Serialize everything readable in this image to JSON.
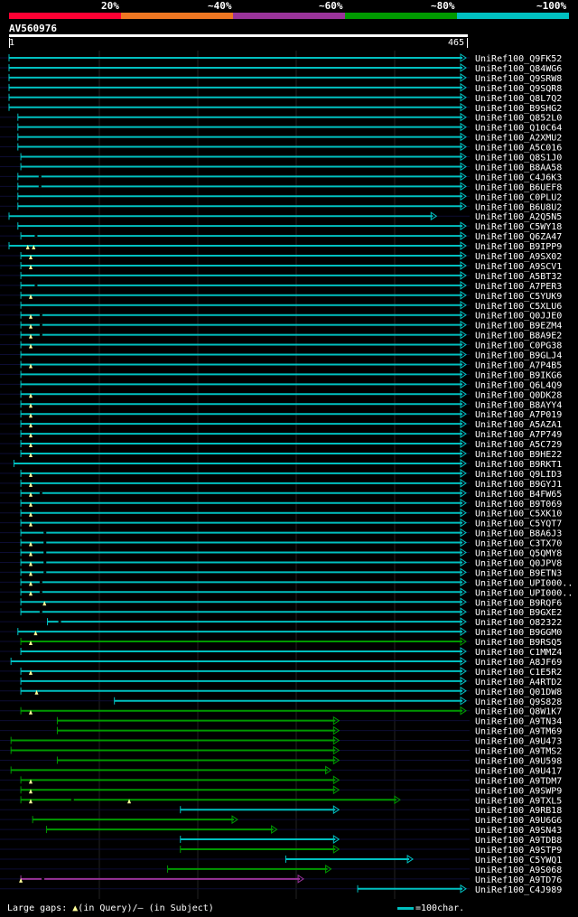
{
  "legend": {
    "labels": [
      "20%",
      "~40%",
      "~60%",
      "~80%",
      "~100%"
    ],
    "colors": [
      "#ff0033",
      "#ee7722",
      "#993399",
      "#009900",
      "#00c0c0"
    ]
  },
  "query": {
    "name": "AV560976",
    "start": "1",
    "end": "465",
    "length": 465
  },
  "footer": {
    "gaps_label": "Large gaps:",
    "query_gap": "(in Query)/",
    "subject_gap": "– (in Subject)",
    "scale_label": "=100char."
  },
  "hits": [
    {
      "id": "UniRef100_Q9FK52",
      "start": 1,
      "end": 465,
      "color": "cyan"
    },
    {
      "id": "UniRef100_Q84WG6",
      "start": 1,
      "end": 465,
      "color": "cyan"
    },
    {
      "id": "UniRef100_Q9SRW8",
      "start": 1,
      "end": 465,
      "color": "cyan"
    },
    {
      "id": "UniRef100_Q9SQR8",
      "start": 1,
      "end": 465,
      "color": "cyan"
    },
    {
      "id": "UniRef100_Q8L7Q2",
      "start": 1,
      "end": 465,
      "color": "cyan"
    },
    {
      "id": "UniRef100_B9SHG2",
      "start": 1,
      "end": 465,
      "color": "cyan"
    },
    {
      "id": "UniRef100_Q852L0",
      "start": 10,
      "end": 465,
      "color": "cyan"
    },
    {
      "id": "UniRef100_Q10C64",
      "start": 10,
      "end": 465,
      "color": "cyan"
    },
    {
      "id": "UniRef100_A2XMU2",
      "start": 10,
      "end": 465,
      "color": "cyan"
    },
    {
      "id": "UniRef100_A5C016",
      "start": 10,
      "end": 465,
      "color": "cyan"
    },
    {
      "id": "UniRef100_Q8S1J0",
      "start": 13,
      "end": 465,
      "color": "cyan"
    },
    {
      "id": "UniRef100_B8AA58",
      "start": 13,
      "end": 465,
      "color": "cyan"
    },
    {
      "id": "UniRef100_C4J6K3",
      "start": 10,
      "end": 465,
      "color": "cyan",
      "sgap": 32
    },
    {
      "id": "UniRef100_B6UEF8",
      "start": 10,
      "end": 465,
      "color": "cyan",
      "sgap": 32
    },
    {
      "id": "UniRef100_C0PLU2",
      "start": 10,
      "end": 465,
      "color": "cyan"
    },
    {
      "id": "UniRef100_B6U8U2",
      "start": 10,
      "end": 465,
      "color": "cyan"
    },
    {
      "id": "UniRef100_A2Q5N5",
      "start": 1,
      "end": 435,
      "color": "cyan"
    },
    {
      "id": "UniRef100_C5WY18",
      "start": 10,
      "end": 465,
      "color": "cyan"
    },
    {
      "id": "UniRef100_Q6ZA47",
      "start": 13,
      "end": 465,
      "color": "cyan",
      "sgap": 28
    },
    {
      "id": "UniRef100_B9IPP9",
      "start": 1,
      "end": 465,
      "color": "cyan",
      "qgap": [
        20,
        26
      ]
    },
    {
      "id": "UniRef100_A9SX02",
      "start": 13,
      "end": 465,
      "color": "cyan",
      "qgap": [
        23
      ]
    },
    {
      "id": "UniRef100_A9SCV1",
      "start": 13,
      "end": 465,
      "color": "cyan",
      "qgap": [
        23
      ]
    },
    {
      "id": "UniRef100_A5BT32",
      "start": 13,
      "end": 465,
      "color": "cyan"
    },
    {
      "id": "UniRef100_A7PER3",
      "start": 13,
      "end": 465,
      "color": "cyan",
      "sgap": 28
    },
    {
      "id": "UniRef100_C5YUK9",
      "start": 13,
      "end": 465,
      "color": "cyan",
      "qgap": [
        23
      ]
    },
    {
      "id": "UniRef100_C5XLU6",
      "start": 13,
      "end": 465,
      "color": "cyan"
    },
    {
      "id": "UniRef100_Q0JJE0",
      "start": 13,
      "end": 465,
      "color": "cyan",
      "qgap": [
        23
      ],
      "sgap": 33
    },
    {
      "id": "UniRef100_B9EZM4",
      "start": 13,
      "end": 465,
      "color": "cyan",
      "qgap": [
        23
      ],
      "sgap": 33
    },
    {
      "id": "UniRef100_B8A9E2",
      "start": 13,
      "end": 465,
      "color": "cyan",
      "qgap": [
        23
      ],
      "sgap": 33
    },
    {
      "id": "UniRef100_C0PG38",
      "start": 13,
      "end": 465,
      "color": "cyan",
      "qgap": [
        23
      ]
    },
    {
      "id": "UniRef100_B9GLJ4",
      "start": 13,
      "end": 465,
      "color": "cyan"
    },
    {
      "id": "UniRef100_A7P4B5",
      "start": 13,
      "end": 465,
      "color": "cyan",
      "qgap": [
        23
      ]
    },
    {
      "id": "UniRef100_B9IKG6",
      "start": 13,
      "end": 465,
      "color": "cyan"
    },
    {
      "id": "UniRef100_Q6L4Q9",
      "start": 13,
      "end": 465,
      "color": "cyan"
    },
    {
      "id": "UniRef100_Q0DK28",
      "start": 13,
      "end": 465,
      "color": "cyan",
      "qgap": [
        23
      ]
    },
    {
      "id": "UniRef100_B8AYY4",
      "start": 13,
      "end": 465,
      "color": "cyan",
      "qgap": [
        23
      ]
    },
    {
      "id": "UniRef100_A7P019",
      "start": 13,
      "end": 465,
      "color": "cyan",
      "qgap": [
        23
      ]
    },
    {
      "id": "UniRef100_A5AZA1",
      "start": 13,
      "end": 465,
      "color": "cyan",
      "qgap": [
        23
      ]
    },
    {
      "id": "UniRef100_A7P749",
      "start": 13,
      "end": 465,
      "color": "cyan",
      "qgap": [
        23
      ]
    },
    {
      "id": "UniRef100_A5C729",
      "start": 13,
      "end": 465,
      "color": "cyan",
      "qgap": [
        23
      ]
    },
    {
      "id": "UniRef100_B9HE22",
      "start": 13,
      "end": 465,
      "color": "cyan",
      "qgap": [
        23
      ]
    },
    {
      "id": "UniRef100_B9RKT1",
      "start": 6,
      "end": 465,
      "color": "cyan"
    },
    {
      "id": "UniRef100_Q9LID3",
      "start": 13,
      "end": 465,
      "color": "cyan",
      "qgap": [
        23
      ]
    },
    {
      "id": "UniRef100_B9GYJ1",
      "start": 13,
      "end": 465,
      "color": "cyan",
      "qgap": [
        23
      ]
    },
    {
      "id": "UniRef100_B4FW65",
      "start": 13,
      "end": 465,
      "color": "cyan",
      "qgap": [
        23
      ],
      "sgap": 33
    },
    {
      "id": "UniRef100_B9T069",
      "start": 13,
      "end": 465,
      "color": "cyan",
      "qgap": [
        23
      ]
    },
    {
      "id": "UniRef100_C5XK10",
      "start": 13,
      "end": 465,
      "color": "cyan",
      "qgap": [
        23
      ]
    },
    {
      "id": "UniRef100_C5YQT7",
      "start": 13,
      "end": 465,
      "color": "cyan",
      "qgap": [
        23
      ]
    },
    {
      "id": "UniRef100_B8A6J3",
      "start": 13,
      "end": 465,
      "color": "cyan",
      "sgap": 37
    },
    {
      "id": "UniRef100_C3TX70",
      "start": 13,
      "end": 465,
      "color": "cyan",
      "qgap": [
        23
      ],
      "sgap": 37
    },
    {
      "id": "UniRef100_Q5QMY8",
      "start": 13,
      "end": 465,
      "color": "cyan",
      "qgap": [
        23
      ],
      "sgap": 37
    },
    {
      "id": "UniRef100_Q0JPV8",
      "start": 13,
      "end": 465,
      "color": "cyan",
      "qgap": [
        23
      ],
      "sgap": 37
    },
    {
      "id": "UniRef100_B9ETN3",
      "start": 13,
      "end": 465,
      "color": "cyan",
      "qgap": [
        23
      ],
      "sgap": 37
    },
    {
      "id": "UniRef100_UPI000..",
      "start": 13,
      "end": 465,
      "color": "cyan",
      "qgap": [
        23
      ],
      "sgap": 33
    },
    {
      "id": "UniRef100_UPI000..",
      "start": 13,
      "end": 465,
      "color": "cyan",
      "qgap": [
        23
      ],
      "sgap": 33
    },
    {
      "id": "UniRef100_B9RQF6",
      "start": 13,
      "end": 465,
      "color": "cyan",
      "qgap": [
        37
      ]
    },
    {
      "id": "UniRef100_B9GXE2",
      "start": 13,
      "end": 465,
      "color": "cyan",
      "sgap": 33
    },
    {
      "id": "UniRef100_O82322",
      "start": 40,
      "end": 465,
      "color": "cyan",
      "sgap": 52
    },
    {
      "id": "UniRef100_B9GGM0",
      "start": 10,
      "end": 465,
      "color": "cyan",
      "qgap": [
        28
      ]
    },
    {
      "id": "UniRef100_B9RSQ5",
      "start": 13,
      "end": 465,
      "color": "green",
      "qgap": [
        23
      ]
    },
    {
      "id": "UniRef100_C1MMZ4",
      "start": 13,
      "end": 465,
      "color": "cyan"
    },
    {
      "id": "UniRef100_A8JF69",
      "start": 3,
      "end": 465,
      "color": "cyan"
    },
    {
      "id": "UniRef100_C1E5R2",
      "start": 13,
      "end": 465,
      "color": "cyan",
      "qgap": [
        23
      ]
    },
    {
      "id": "UniRef100_A4RTD2",
      "start": 13,
      "end": 465,
      "color": "cyan"
    },
    {
      "id": "UniRef100_Q01DW8",
      "start": 13,
      "end": 465,
      "color": "cyan",
      "qgap": [
        29
      ]
    },
    {
      "id": "UniRef100_Q9S828",
      "start": 108,
      "end": 465,
      "color": "cyan"
    },
    {
      "id": "UniRef100_Q8W1K7",
      "start": 13,
      "end": 465,
      "color": "green",
      "qgap": [
        23
      ]
    },
    {
      "id": "UniRef100_A9TN34",
      "start": 50,
      "end": 336,
      "color": "green"
    },
    {
      "id": "UniRef100_A9TM69",
      "start": 50,
      "end": 336,
      "color": "green"
    },
    {
      "id": "UniRef100_A9U473",
      "start": 3,
      "end": 336,
      "color": "green"
    },
    {
      "id": "UniRef100_A9TMS2",
      "start": 3,
      "end": 336,
      "color": "green"
    },
    {
      "id": "UniRef100_A9U598",
      "start": 50,
      "end": 336,
      "color": "green"
    },
    {
      "id": "UniRef100_A9U417",
      "start": 3,
      "end": 328,
      "color": "green"
    },
    {
      "id": "UniRef100_A9TDM7",
      "start": 13,
      "end": 336,
      "color": "green",
      "qgap": [
        23
      ]
    },
    {
      "id": "UniRef100_A9SWP9",
      "start": 13,
      "end": 336,
      "color": "green",
      "qgap": [
        23
      ]
    },
    {
      "id": "UniRef100_A9TXL5",
      "start": 13,
      "end": 398,
      "color": "green",
      "qgap": [
        23,
        123
      ],
      "sgap": 65
    },
    {
      "id": "UniRef100_A9RB18",
      "start": 175,
      "end": 336,
      "color": "cyan"
    },
    {
      "id": "UniRef100_A9U6G6",
      "start": 25,
      "end": 233,
      "color": "green"
    },
    {
      "id": "UniRef100_A9SN43",
      "start": 39,
      "end": 273,
      "color": "green"
    },
    {
      "id": "UniRef100_A9TDB8",
      "start": 175,
      "end": 336,
      "color": "cyan"
    },
    {
      "id": "UniRef100_A9STP9",
      "start": 175,
      "end": 336,
      "color": "green"
    },
    {
      "id": "UniRef100_C5YWQ1",
      "start": 282,
      "end": 411,
      "color": "cyan"
    },
    {
      "id": "UniRef100_A9S068",
      "start": 162,
      "end": 328,
      "color": "green"
    },
    {
      "id": "UniRef100_A9TD76",
      "start": 13,
      "end": 300,
      "color": "purple",
      "qgap": [
        13
      ],
      "sgap": 35
    },
    {
      "id": "UniRef100_C4J989",
      "start": 355,
      "end": 465,
      "color": "cyan"
    }
  ]
}
